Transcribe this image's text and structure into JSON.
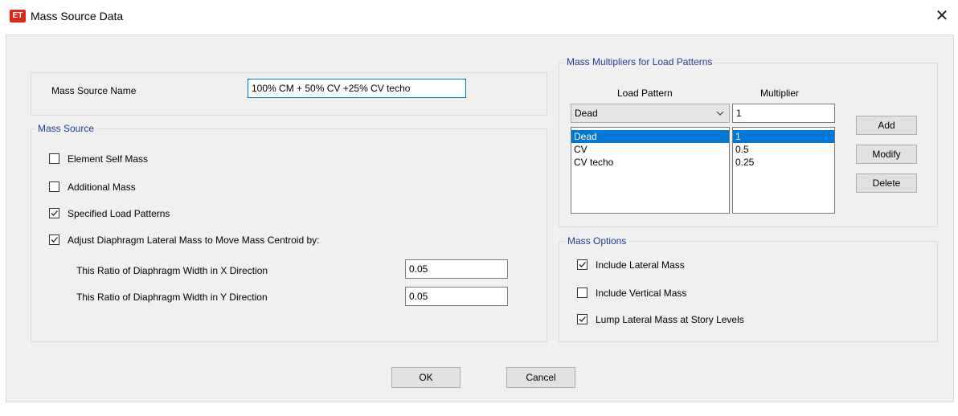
{
  "window": {
    "title": "Mass Source Data",
    "app_icon_text": "ET"
  },
  "mass_source_name": {
    "label": "Mass Source Name",
    "value": "100% CM + 50% CV +25% CV techo"
  },
  "mass_source": {
    "legend": "Mass Source",
    "element_self_mass": {
      "label": "Element Self Mass",
      "checked": false
    },
    "additional_mass": {
      "label": "Additional Mass",
      "checked": false
    },
    "specified_load_patterns": {
      "label": "Specified Load Patterns",
      "checked": true
    },
    "adjust_diaphragm": {
      "label": "Adjust Diaphragm Lateral Mass to Move Mass Centroid by:",
      "checked": true
    },
    "ratio_x": {
      "label": "This Ratio of Diaphragm Width in X Direction",
      "value": "0.05"
    },
    "ratio_y": {
      "label": "This Ratio of Diaphragm Width in Y Direction",
      "value": "0.05"
    }
  },
  "multipliers": {
    "legend": "Mass Multipliers for Load Patterns",
    "col_load_pattern": "Load Pattern",
    "col_multiplier": "Multiplier",
    "combo_value": "Dead",
    "multiplier_input": "1",
    "rows": [
      {
        "pattern": "Dead",
        "multiplier": "1",
        "selected": true
      },
      {
        "pattern": "CV",
        "multiplier": "0.5",
        "selected": false
      },
      {
        "pattern": "CV techo",
        "multiplier": "0.25",
        "selected": false
      }
    ],
    "add_label": "Add",
    "modify_label": "Modify",
    "delete_label": "Delete"
  },
  "mass_options": {
    "legend": "Mass Options",
    "include_lateral": {
      "label": "Include Lateral Mass",
      "checked": true
    },
    "include_vertical": {
      "label": "Include Vertical Mass",
      "checked": false
    },
    "lump_lateral": {
      "label": "Lump Lateral Mass at Story Levels",
      "checked": true
    }
  },
  "footer": {
    "ok_label": "OK",
    "cancel_label": "Cancel"
  },
  "colors": {
    "accent": "#0078d7",
    "group_title": "#1f3f8f",
    "app_icon": "#d9281e"
  }
}
